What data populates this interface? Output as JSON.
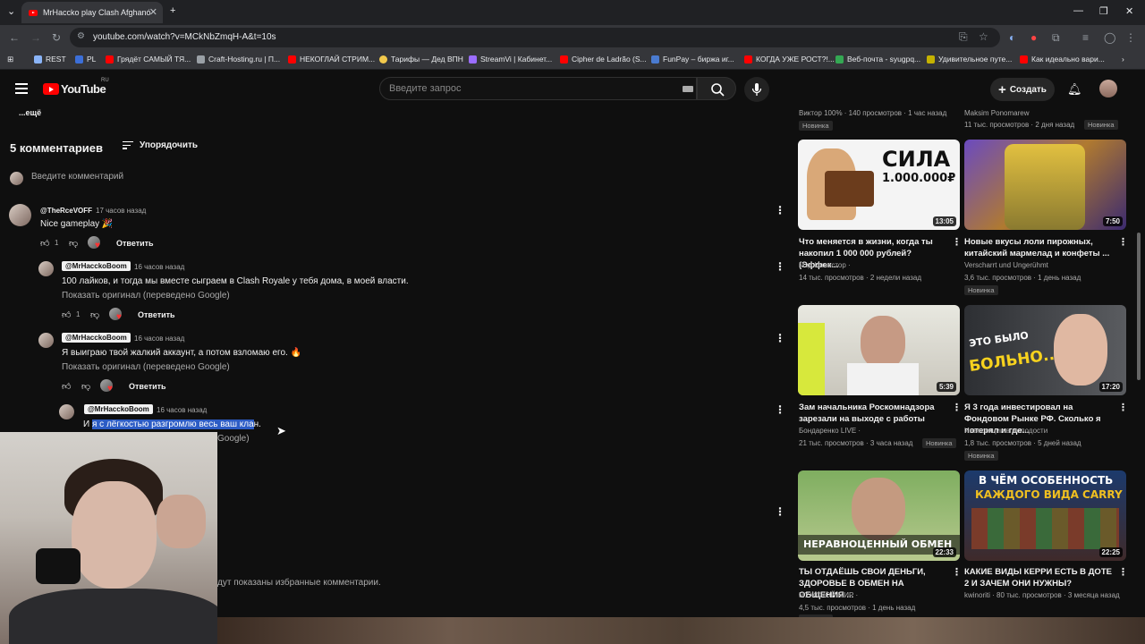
{
  "browser": {
    "tab_title": "MrHaccko play Clash Afghanó",
    "url": "youtube.com/watch?v=MCkNbZmqH-A&t=10s",
    "bookmarks": [
      {
        "label": "REST",
        "color": "#8ab4f8"
      },
      {
        "label": "PL",
        "color": "#3c6fd8"
      },
      {
        "label": "Грядёт САМЫЙ ТЯ...",
        "color": "#ff0000"
      },
      {
        "label": "Craft-Hosting.ru | П...",
        "color": "#9aa0a6"
      },
      {
        "label": "НЕКОГЛАЙ СТРИМ...",
        "color": "#ff0000"
      },
      {
        "label": "Тарифы — Дед ВПН",
        "color": "#f2c94c"
      },
      {
        "label": "StreamVi | Кабинет...",
        "color": "#9b6dff"
      },
      {
        "label": "Cipher de Ladrão (S...",
        "color": "#ff0000"
      },
      {
        "label": "FunPay – биржа иг...",
        "color": "#4a7bd0"
      },
      {
        "label": "КОГДА УЖЕ РОСТ?!...",
        "color": "#ff0000"
      },
      {
        "label": "Веб-почта - syugpq...",
        "color": "#34a853"
      },
      {
        "label": "Удивительное путе...",
        "color": "#c5b200"
      },
      {
        "label": "Как идеально вари...",
        "color": "#ff0000"
      }
    ]
  },
  "header": {
    "logo_text": "YouTube",
    "logo_region": "RU",
    "search_placeholder": "Введите запрос",
    "create_label": "Создать"
  },
  "comments": {
    "more_label": "...ещё",
    "count_label": "5 комментариев",
    "sort_label": "Упорядочить",
    "add_placeholder": "Введите комментарий",
    "reply_label": "Ответить",
    "show_original": "Показать оригинал (переведено Google)",
    "c1": {
      "author": "@TheRceVOFF",
      "time": "17 часов назад",
      "text": "Nice gameplay 🎉",
      "likes": "1"
    },
    "r1": {
      "author": "@MrHacckoBoom",
      "time": "16 часов назад",
      "text": "100 лайков, и тогда мы вместе сыграем в Clash Royale у тебя дома, в моей власти.",
      "likes": "1"
    },
    "r2": {
      "author": "@MrHacckoBoom",
      "time": "16 часов назад",
      "text": "Я выиграю твой жалкий аккаунт, а потом взломаю его. 🔥"
    },
    "r3": {
      "author": "@MrHacckoBoom",
      "time": "16 часов назад",
      "text_pre": "И ",
      "text_hl": "я с лёгкостью разгромлю весь ваш кла",
      "text_post": "н."
    },
    "cut_text1": "Google)",
    "cut_text2": "дут показаны избранные комментарии."
  },
  "sidebar": {
    "top_left_meta": "Виктор 100% · 140 просмотров · 1 час назад",
    "top_left_badge": "Новинка",
    "top_right_meta": "Maksim Ponomarew",
    "top_right_meta2": "11 тыс. просмотров · 2 дня назад",
    "top_right_badge": "Новинка",
    "videos": [
      {
        "title": "Что меняется в жизни, когда ты накопил 1 000 000 рублей? (Эффек...",
        "channel": "Мэд Инвестор ·",
        "meta": "14 тыс. просмотров · 2 недели назад",
        "duration": "13:05",
        "badge": "",
        "thumb_text": "СИЛА",
        "thumb_text2": "1.000.000₽"
      },
      {
        "title": "Новые вкусы лоли пирожных, китайский мармелад и конфеты ...",
        "channel": "Verscharrt und Ungerühmt",
        "meta": "3,6 тыс. просмотров · 1 день назад",
        "duration": "7:50",
        "badge": "Новинка",
        "thumb_text": "",
        "thumb_text2": ""
      },
      {
        "title": "Зам начальника Роскомнадзора зарезали на выходе с работы",
        "channel": "Бондаренко LIVE ·",
        "meta": "21 тыс. просмотров · 3 часа назад",
        "duration": "5:39",
        "badge": "Новинка",
        "thumb_text": "",
        "thumb_text2": ""
      },
      {
        "title": "Я 3 года инвестировал на Фондовом Рынке РФ. Сколько я потерял и где...",
        "channel": "Инвестиции в молодости",
        "meta": "1,8 тыс. просмотров · 5 дней назад",
        "duration": "17:20",
        "badge": "Новинка",
        "thumb_text": "ЭТО БЫЛО",
        "thumb_text2": "БОЛЬНО..."
      },
      {
        "title": "ТЫ ОТДАЁШЬ СВОИ ДЕНЬГИ, ЗДОРОВЬЕ В ОБМЕН НА ОБЩЕНИЯ ...",
        "channel": "МУЖСКОЙ МИР ·",
        "meta": "4,5 тыс. просмотров · 1 день назад",
        "duration": "22:33",
        "badge": "Новинка",
        "thumb_text": "НЕРАВНОЦЕННЫЙ ОБМЕН",
        "thumb_text2": ""
      },
      {
        "title": "КАКИЕ ВИДЫ КЕРРИ ЕСТЬ В ДОТЕ 2 И ЗАЧЕМ ОНИ НУЖНЫ?",
        "channel": "kwinoriti · 80 тыс. просмотров · 3 месяца назад",
        "meta": "",
        "duration": "22:25",
        "badge": "",
        "thumb_text": "В ЧЁМ ОСОБЕННОСТЬ",
        "thumb_text2": "КАЖДОГО ВИДА CARRY"
      }
    ]
  }
}
